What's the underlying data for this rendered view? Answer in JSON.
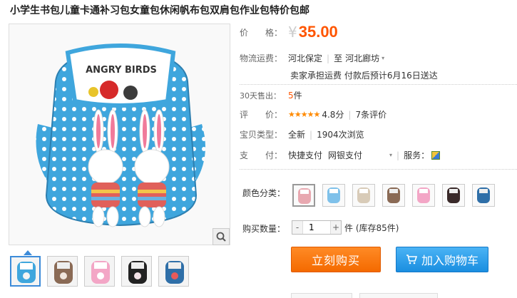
{
  "title": "小学生书包儿童卡通补习包女童包休闲帆布包双肩包作业包特价包邮",
  "main_image": {
    "alt": "blue polka-dot backpack with ANGRY BIRDS patch and two bunny plush toys",
    "patch_text": "ANGRY BIRDS"
  },
  "price": {
    "label": "价　　格：",
    "currency": "¥",
    "value": "35.00"
  },
  "shipping": {
    "label": "物流运费：",
    "from": "河北保定",
    "to_sep": "至",
    "to": "河北廊坊",
    "detail": "卖家承担运费 付款后预计6月16日送达"
  },
  "sales": {
    "label": "30天售出：",
    "count": "5",
    "unit": "件"
  },
  "rating": {
    "label": "评　　价：",
    "stars": "★★★★★",
    "score": "4.8分",
    "reviews": "7条评价"
  },
  "type": {
    "label": "宝贝类型：",
    "value": "全新",
    "views": "1904次浏览"
  },
  "payment": {
    "label": "支　　付：",
    "opt1": "快捷支付",
    "opt2": "网银支付",
    "service_label": "服务："
  },
  "color": {
    "label": "颜色分类："
  },
  "quantity": {
    "label": "购买数量：",
    "value": "1",
    "minus": "-",
    "plus": "+",
    "stock": "件 (库存85件)"
  },
  "buttons": {
    "buy": "立刻购买",
    "cart": "加入购物车"
  },
  "colors": {
    "accent": "#ff5500",
    "buy": "#f47a10",
    "cart": "#2a9aea",
    "bag_blue": "#3fa6dd"
  },
  "icons": [
    "search-icon",
    "cart-icon",
    "chevron-down-icon",
    "service-icon"
  ]
}
